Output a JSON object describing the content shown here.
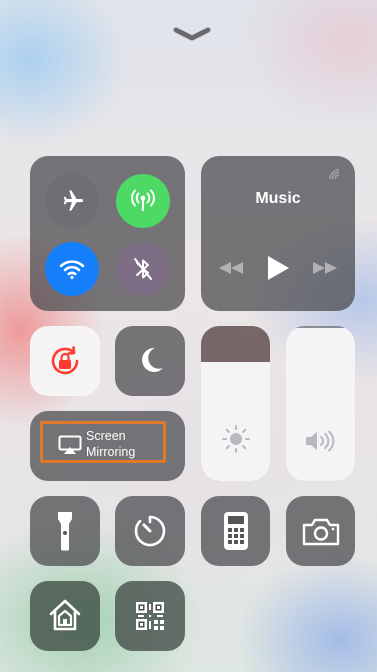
{
  "header": {
    "dismiss_icon": "chevron-down-icon"
  },
  "connectivity": {
    "airplane": {
      "icon": "airplane-icon",
      "active": false
    },
    "cellular": {
      "icon": "cellular-data-icon",
      "active": true,
      "color": "#4cd964"
    },
    "wifi": {
      "icon": "wifi-icon",
      "active": true,
      "color": "#157efb"
    },
    "bluetooth": {
      "icon": "bluetooth-icon",
      "active": false
    }
  },
  "music": {
    "title": "Music",
    "airplay_icon": "airplay-audio-icon",
    "controls": [
      "rewind-icon",
      "play-icon",
      "fast-forward-icon"
    ]
  },
  "toggles": {
    "orientation_lock": {
      "icon": "orientation-lock-icon",
      "active": true,
      "color": "#ff3b30"
    },
    "do_not_disturb": {
      "icon": "moon-icon",
      "active": false
    }
  },
  "screen_mirroring": {
    "line1": "Screen",
    "line2": "Mirroring",
    "highlight_color": "#e07a2a"
  },
  "brightness": {
    "icon": "sun-icon",
    "level": 0.77
  },
  "volume": {
    "icon": "speaker-icon",
    "level": 0.99
  },
  "shortcuts": [
    {
      "name": "flashlight",
      "icon": "flashlight-icon"
    },
    {
      "name": "timer",
      "icon": "timer-icon"
    },
    {
      "name": "calculator",
      "icon": "calculator-icon"
    },
    {
      "name": "camera",
      "icon": "camera-icon"
    },
    {
      "name": "home",
      "icon": "home-icon"
    },
    {
      "name": "qr-scanner",
      "icon": "qr-code-icon"
    }
  ]
}
